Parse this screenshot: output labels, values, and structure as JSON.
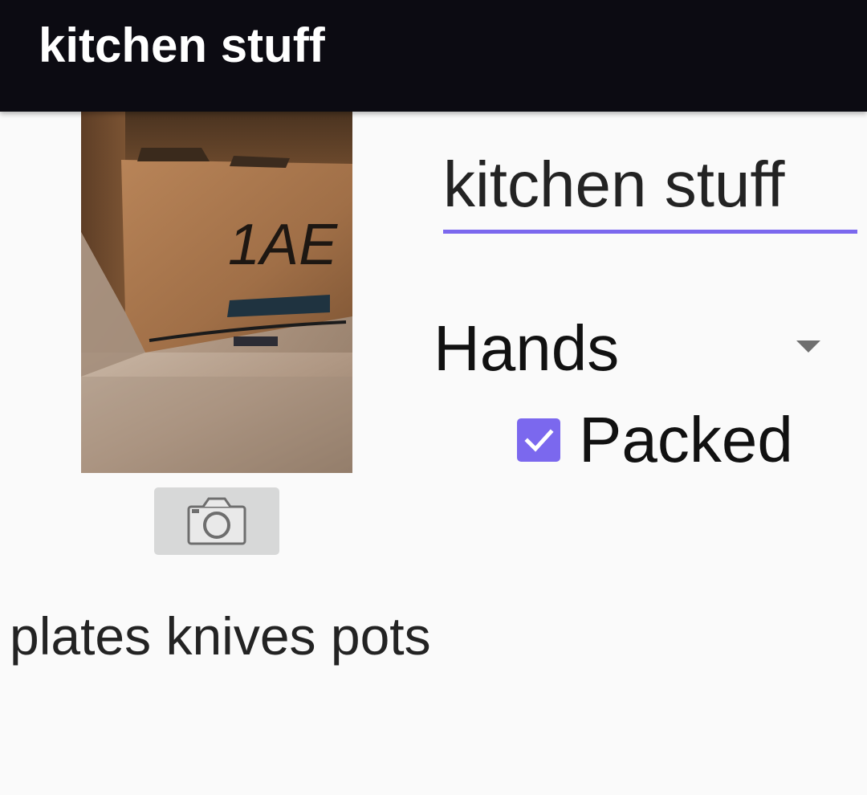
{
  "app_bar": {
    "title": "kitchen stuff"
  },
  "photo": {
    "box_label": "1AE"
  },
  "camera_button": {
    "icon": "camera-icon"
  },
  "box_name": {
    "value": "kitchen stuff",
    "underline_color": "#7b68ee"
  },
  "owner": {
    "selected": "Hands"
  },
  "packed": {
    "label": "Packed",
    "checked": true,
    "color": "#7b68ee"
  },
  "contents": {
    "text": "plates knives pots"
  },
  "colors": {
    "app_bar": "#0c0b12",
    "background": "#fafafa",
    "accent": "#7b68ee"
  }
}
